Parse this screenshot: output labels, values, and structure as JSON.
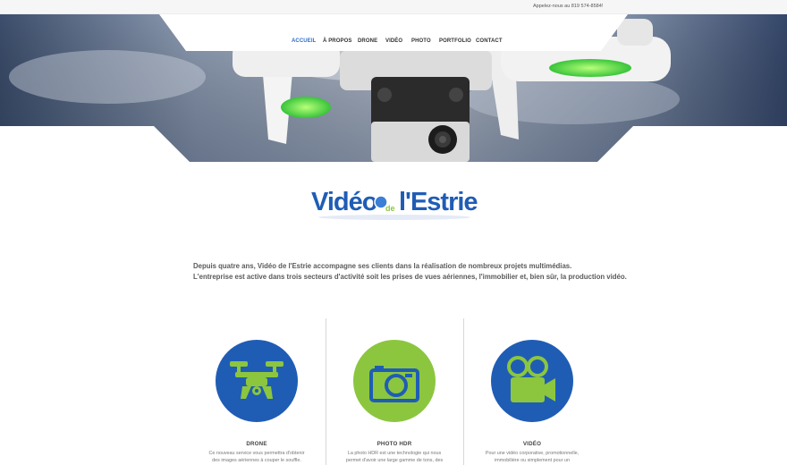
{
  "topbar": {
    "phone": "Appelez-nous au 819 574-8584!"
  },
  "nav": {
    "items": [
      {
        "label": "ACCUEIL",
        "active": true
      },
      {
        "label": "À PROPOS",
        "active": false
      },
      {
        "label": "DRONE",
        "active": false
      },
      {
        "label": "VIDÉO",
        "active": false
      },
      {
        "label": "PHOTO",
        "active": false
      },
      {
        "label": "PORTFOLIO",
        "active": false
      },
      {
        "label": "CONTACT",
        "active": false
      }
    ]
  },
  "hero": {
    "image": "drone-with-camera-photo"
  },
  "logo": {
    "part1": "Vidéo",
    "part2": "de",
    "part3": "l'Estrie"
  },
  "intro": {
    "line1": "Depuis quatre ans, Vidéo de l'Estrie accompagne ses clients dans la réalisation de nombreux projets multimédias.",
    "line2": "L'entreprise est active dans trois secteurs d'activité soit les prises de vues aériennes, l'immobilier et, bien sûr, la production vidéo."
  },
  "services": [
    {
      "title": "DRONE",
      "icon": "drone-icon",
      "circle_color": "#1f5db5",
      "desc1": "Ce nouveau service vous permettra d'obtenir",
      "desc2": "des images aériennes à couper le souffle."
    },
    {
      "title": "PHOTO HDR",
      "icon": "camera-icon",
      "circle_color": "#8cc63f",
      "desc1": "La photo HDR est une technologie qui nous",
      "desc2": "permet d'avoir une large gamme de tons, des"
    },
    {
      "title": "VIDÉO",
      "icon": "video-camera-icon",
      "circle_color": "#1f5db5",
      "desc1": "Pour une vidéo corporative, promotionnelle,",
      "desc2": "immobilière ou simplement pour un"
    }
  ],
  "colors": {
    "accent_blue": "#1f5db5",
    "accent_green": "#8cc63f",
    "nav_active": "#2d6fc8"
  }
}
